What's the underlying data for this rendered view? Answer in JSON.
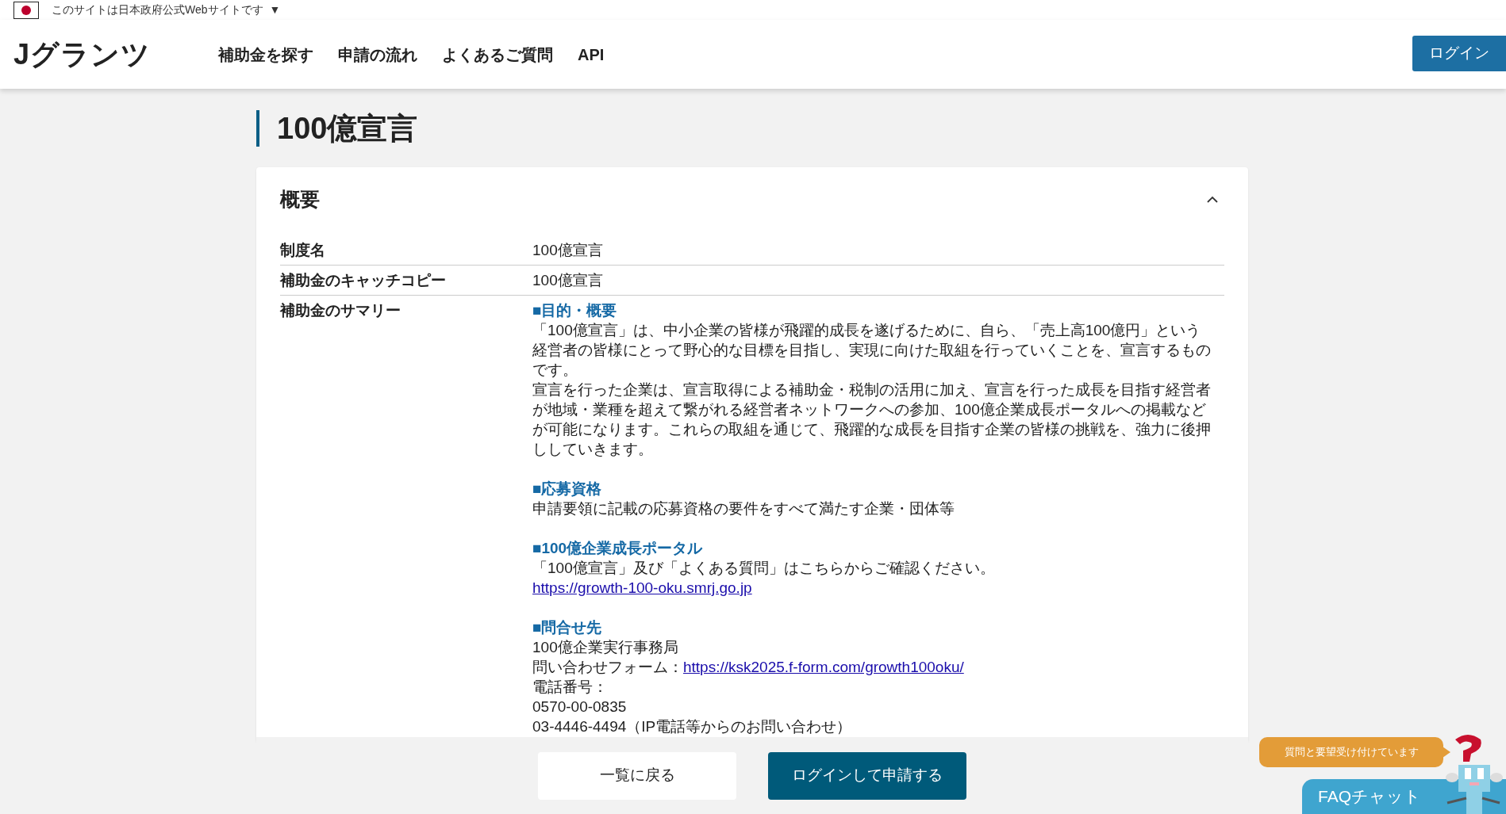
{
  "gov_banner": {
    "text": "このサイトは日本政府公式Webサイトです",
    "caret": "▼"
  },
  "header": {
    "logo": "Jグランツ",
    "nav": [
      "補助金を探す",
      "申請の流れ",
      "よくあるご質問",
      "API"
    ],
    "login": "ログイン"
  },
  "page_title": "100億宣言",
  "section": {
    "title": "概要",
    "expanded": true,
    "rows": [
      {
        "label": "制度名",
        "value": "100億宣言"
      },
      {
        "label": "補助金のキャッチコピー",
        "value": "100億宣言"
      },
      {
        "label": "補助金のサマリー",
        "blocks": [
          {
            "heading": "■目的・概要",
            "items": [
              {
                "kind": "text",
                "text": "「100億宣言」は、中小企業の皆様が飛躍的成長を遂げるために、自ら、「売上高100億円」という経営者の皆様にとって野心的な目標を目指し、実現に向けた取組を行っていくことを、宣言するものです。"
              },
              {
                "kind": "text",
                "text": "宣言を行った企業は、宣言取得による補助金・税制の活用に加え、宣言を行った成長を目指す経営者が地域・業種を超えて繋がれる経営者ネットワークへの参加、100億企業成長ポータルへの掲載などが可能になります。これらの取組を通じて、飛躍的な成長を目指す企業の皆様の挑戦を、強力に後押ししていきます。"
              }
            ]
          },
          {
            "heading": "■応募資格",
            "items": [
              {
                "kind": "text",
                "text": "申請要領に記載の応募資格の要件をすべて満たす企業・団体等"
              }
            ]
          },
          {
            "heading": "■100億企業成長ポータル",
            "items": [
              {
                "kind": "text",
                "text": "「100億宣言」及び「よくある質問」はこちらからご確認ください。"
              },
              {
                "kind": "link",
                "text": "https://growth-100-oku.smrj.go.jp"
              }
            ]
          },
          {
            "heading": "■問合せ先",
            "items": [
              {
                "kind": "text",
                "text": "100億企業実行事務局"
              },
              {
                "kind": "labeled_link",
                "label": "問い合わせフォーム：",
                "text": "https://ksk2025.f-form.com/growth100oku/"
              },
              {
                "kind": "text",
                "text": "電話番号："
              },
              {
                "kind": "text",
                "text": "0570-00-0835"
              },
              {
                "kind": "text",
                "text": "03-4446-4494（IP電話等からのお問い合わせ）"
              }
            ]
          }
        ]
      }
    ]
  },
  "actions": [
    {
      "label": "一覧に戻る",
      "kind": "secondary"
    },
    {
      "label": "ログインして申請する",
      "kind": "primary"
    }
  ],
  "faq": {
    "bubble": "質問と要望受け付けています",
    "button": "FAQチャット"
  }
}
